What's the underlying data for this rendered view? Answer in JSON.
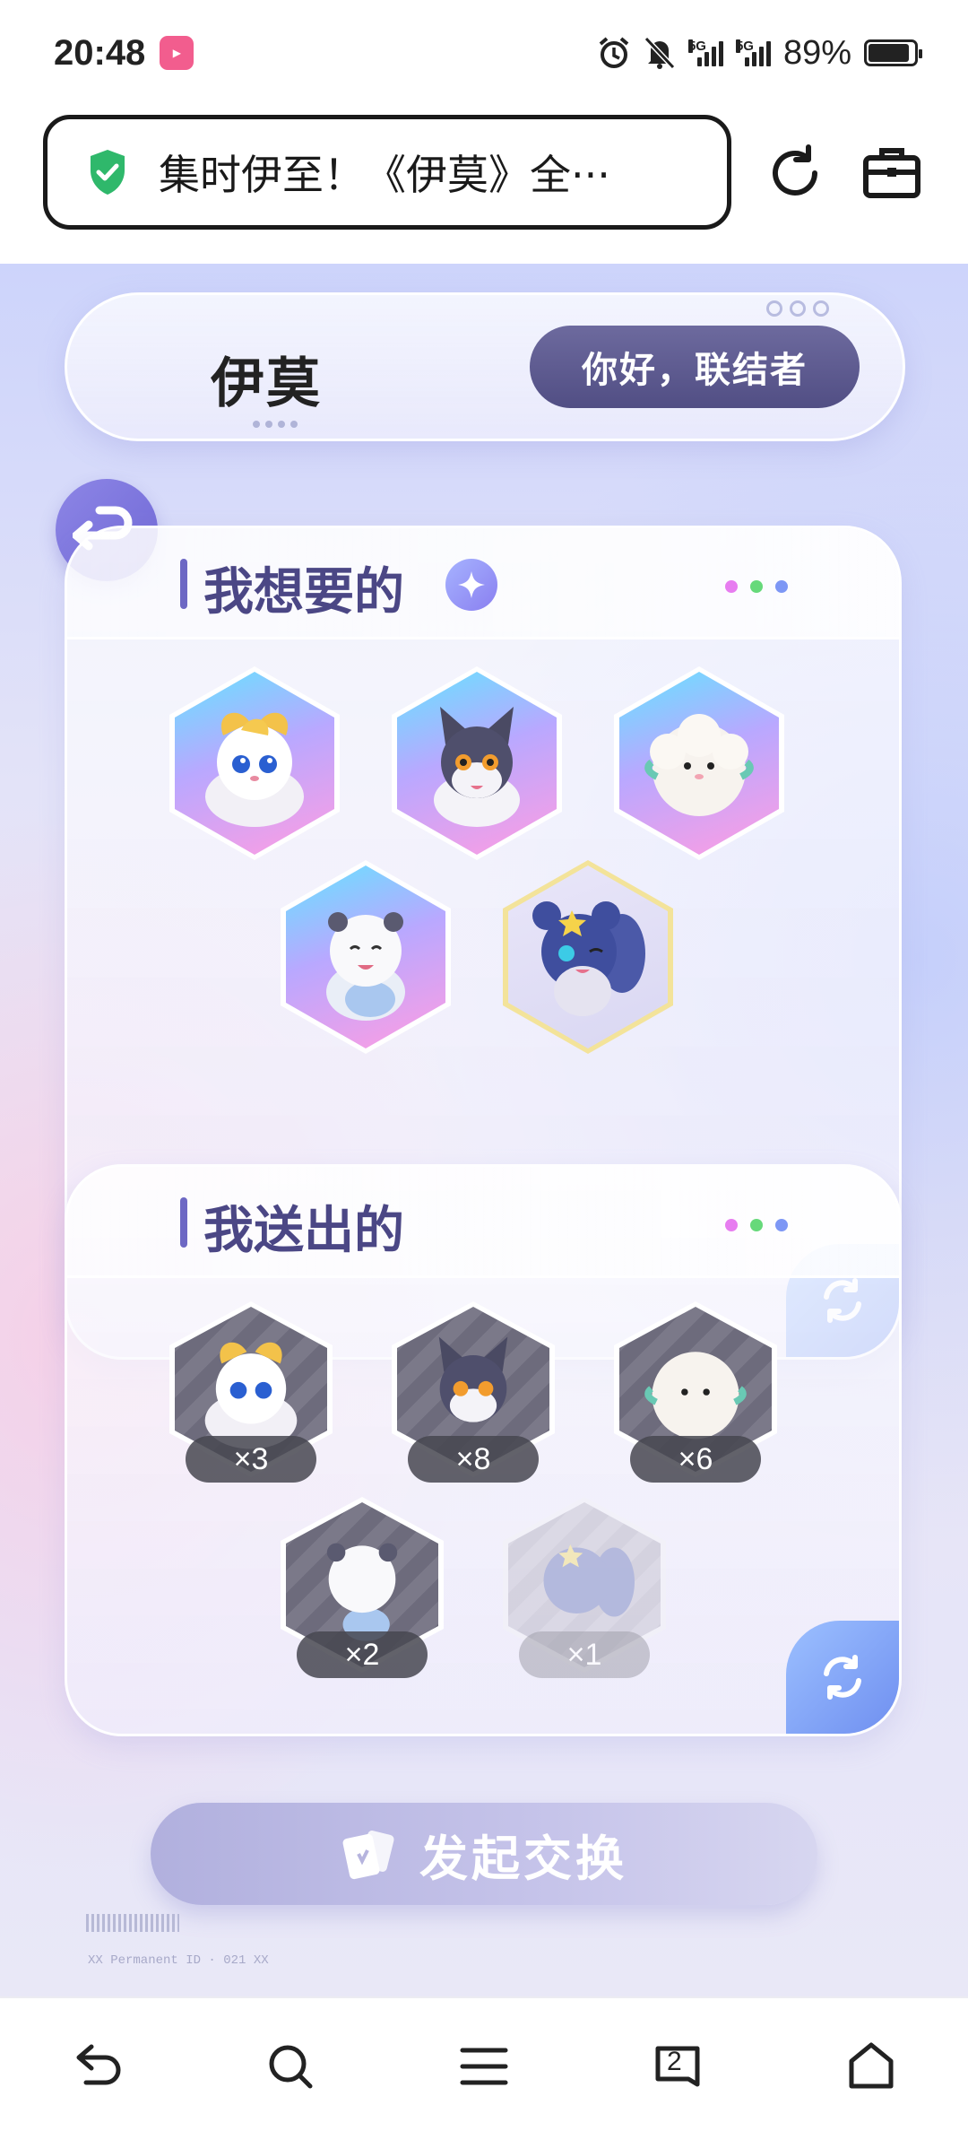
{
  "status_bar": {
    "time": "20:48",
    "app_badge_icon": "bilibili-icon",
    "net_1": "5G",
    "net_2": "5G",
    "battery": "89%",
    "battery_level": 0.89
  },
  "browser": {
    "url_title": "集时伊至！《伊莫》全···",
    "secure_icon": "shield-check-icon"
  },
  "header": {
    "logo": "伊莫",
    "greeting": "你好，联结者"
  },
  "want_panel": {
    "title": "我想要的",
    "dot_colors": [
      "#e77df0",
      "#66d97a",
      "#7d97f5"
    ],
    "creatures": [
      "golden-fox",
      "dark-fox",
      "fluffy-sheep",
      "white-bear",
      "blue-squirrel"
    ]
  },
  "give_panel": {
    "title": "我送出的",
    "dot_colors": [
      "#e77df0",
      "#66d97a",
      "#7d97f5"
    ],
    "items": [
      {
        "creature": "golden-fox",
        "count": "×3"
      },
      {
        "creature": "dark-fox",
        "count": "×8"
      },
      {
        "creature": "fluffy-sheep",
        "count": "×6"
      },
      {
        "creature": "white-bear",
        "count": "×2"
      },
      {
        "creature": "blue-squirrel",
        "count": "×1"
      }
    ]
  },
  "actions": {
    "exchange": "发起交换"
  },
  "footer": {
    "code": "XX Permanent ID · 021 XX"
  },
  "bottom_nav": [
    "back-icon",
    "search-icon",
    "menu-icon",
    "tabs-icon",
    "home-icon"
  ],
  "tab_count": "2",
  "colors": {
    "accent": "#6d68c4",
    "title": "#4b4785",
    "greeting_bg": "#5f5c93"
  }
}
